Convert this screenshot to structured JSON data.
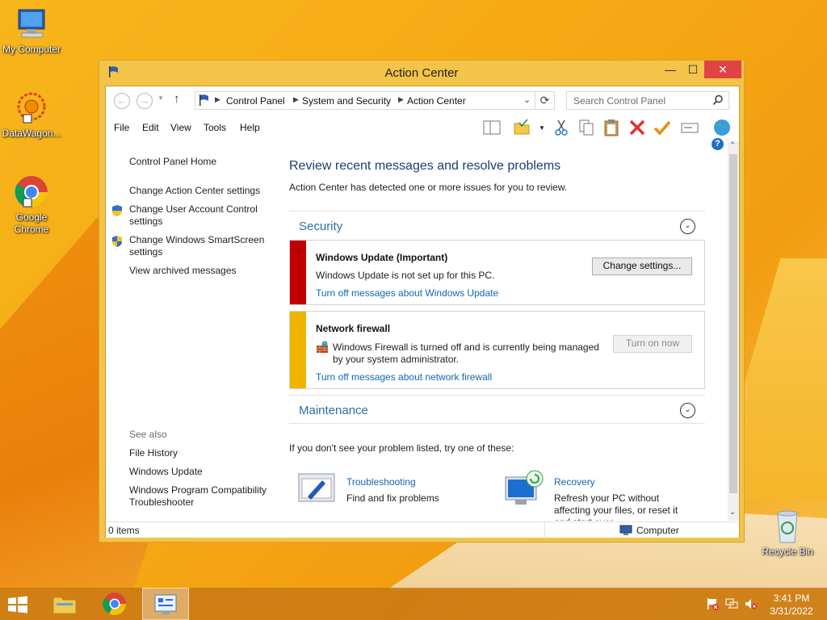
{
  "desktop": {
    "icons": [
      {
        "label": "My Computer"
      },
      {
        "label": "DataWagon..."
      },
      {
        "label": "Google Chrome"
      },
      {
        "label": "Recycle Bin"
      }
    ]
  },
  "window": {
    "title": "Action Center",
    "controls": {
      "minimize": "—",
      "maximize": "☐",
      "close": "✕"
    }
  },
  "address": {
    "breadcrumbs": [
      "Control Panel",
      "System and Security",
      "Action Center"
    ],
    "search_placeholder": "Search Control Panel"
  },
  "menu": {
    "items": [
      "File",
      "Edit",
      "View",
      "Tools",
      "Help"
    ]
  },
  "left_pane": {
    "links": [
      "Control Panel Home",
      "Change Action Center settings",
      "Change User Account Control settings",
      "Change Windows SmartScreen settings",
      "View archived messages"
    ],
    "see_also_title": "See also",
    "see_also": [
      "File History",
      "Windows Update",
      "Windows Program Compatibility Troubleshooter"
    ]
  },
  "main": {
    "heading": "Review recent messages and resolve problems",
    "subheading": "Action Center has detected one or more issues for you to review.",
    "security_label": "Security",
    "maintenance_label": "Maintenance",
    "messages": [
      {
        "title": "Windows Update  (Important)",
        "text": "Windows Update is not set up for this PC.",
        "link": "Turn off messages about Windows Update",
        "button": "Change settings...",
        "color": "#c00000"
      },
      {
        "title": "Network firewall",
        "text": "Windows Firewall is turned off and is currently being managed by your system administrator.",
        "link": "Turn off messages about network firewall",
        "button": "Turn on now",
        "color": "#f0b400"
      }
    ],
    "suggestion": "If you don't see your problem listed, try one of these:",
    "troubleshooting": {
      "title": "Troubleshooting",
      "desc": "Find and fix problems"
    },
    "recovery": {
      "title": "Recovery",
      "desc": "Refresh your PC without affecting your files, or reset it and start over"
    }
  },
  "status": {
    "items": "0 items",
    "location": "Computer"
  },
  "taskbar": {
    "time": "3:41 PM",
    "date": "3/31/2022"
  }
}
